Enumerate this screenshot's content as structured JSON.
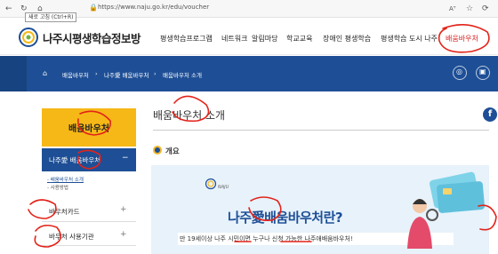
{
  "browser": {
    "url": "https://www.naju.go.kr/edu/voucher",
    "reload_tooltip": "새로 고침 (Ctrl+R)",
    "read_aloud": "Aᵀ"
  },
  "header": {
    "site_title": "나주시평생학습정보방",
    "nav": [
      "평생학습프로그램",
      "네트워크",
      "알림마당",
      "학교교육",
      "장애인 평생학습",
      "평생학습 도시 나주",
      "배움바우처"
    ]
  },
  "breadcrumb": {
    "items": [
      "배움바우처",
      "나주愛 배움바우처",
      "배움바우처 소개"
    ]
  },
  "sidebar": {
    "heading": "배움바우처",
    "submenu_title": "나주愛 배움바우처",
    "submenu_toggle": "−",
    "links": [
      "배움바우처 소개",
      "사용방법"
    ],
    "items": [
      "바우처카드",
      "바우처 사용기관"
    ],
    "expand": "+"
  },
  "content": {
    "page_title": "배움바우처 소개",
    "section": "개요",
    "promo": {
      "brand": "NAJU",
      "title": "나주愛배움바우처란?",
      "subtitle": "만 19세이상 나주 시민이면 누구나 신청 가능한 나주애배움바우처!"
    },
    "facebook": "f"
  },
  "colors": {
    "primary": "#1e4f96",
    "accent": "#f6b817",
    "nav_active": "#d81e1e",
    "annotation": "#e2231a"
  }
}
